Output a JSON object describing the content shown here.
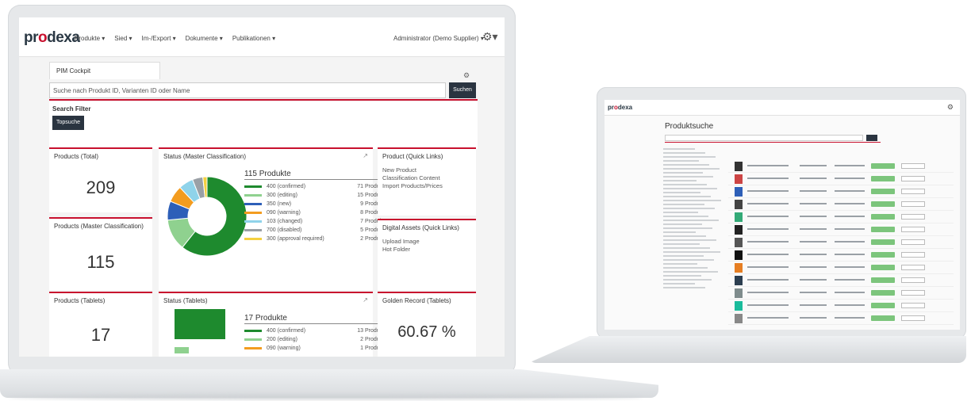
{
  "nav": {
    "logo_pre": "pr",
    "logo_accent": "o",
    "logo_post": "dexa",
    "menu": [
      "Produkte ▾",
      "Sied ▾",
      "Im-/Export ▾",
      "Dokumente ▾",
      "Publikationen ▾"
    ],
    "user": "Administrator (Demo Supplier) ▾"
  },
  "tab": {
    "label": "PIM Cockpit"
  },
  "search": {
    "placeholder": "Suche nach Produkt ID, Varianten ID oder Name",
    "button": "Suchen"
  },
  "filter": {
    "title": "Search Filter",
    "button": "Topsuche"
  },
  "cards": {
    "products_total": {
      "title": "Products (Total)",
      "value": "209"
    },
    "products_master": {
      "title": "Products (Master Classification)",
      "value": "115"
    },
    "products_tablets": {
      "title": "Products (Tablets)",
      "value": "17"
    },
    "status_master": {
      "title": "Status (Master Classification)",
      "heading": "115 Produkte",
      "legend": [
        {
          "label": "400 (confirmed)",
          "count": "71 Produkte",
          "color": "#1e8a2e"
        },
        {
          "label": "300 (editing)",
          "count": "15 Produkte",
          "color": "#8fd18f"
        },
        {
          "label": "350 (new)",
          "count": "9 Produkte",
          "color": "#2d5fb8"
        },
        {
          "label": "090 (warning)",
          "count": "8 Produkte",
          "color": "#f39c1f"
        },
        {
          "label": "103 (changed)",
          "count": "7 Produkte",
          "color": "#8fd3ea"
        },
        {
          "label": "700 (disabled)",
          "count": "5 Produkte",
          "color": "#9aa0a6"
        },
        {
          "label": "300 (approval required)",
          "count": "2 Produkte",
          "color": "#f4d03f"
        }
      ]
    },
    "status_tablets": {
      "title": "Status (Tablets)",
      "heading": "17 Produkte",
      "legend": [
        {
          "label": "400 (confirmed)",
          "count": "13 Produkte",
          "color": "#1e8a2e"
        },
        {
          "label": "200 (editing)",
          "count": "2 Produkte",
          "color": "#8fd18f"
        },
        {
          "label": "090 (warning)",
          "count": "1 Produkte",
          "color": "#f39c1f"
        }
      ]
    },
    "quick_links": {
      "title": "Product (Quick Links)",
      "links": [
        "New Product",
        "Classification Content",
        "Import Products/Prices"
      ]
    },
    "digital_assets": {
      "title": "Digital Assets (Quick Links)",
      "links": [
        "Upload Image",
        "Hot Folder"
      ]
    },
    "golden_record": {
      "title": "Golden Record (Tablets)",
      "value": "60.67 %"
    }
  },
  "small_screen": {
    "title": "Produktsuche",
    "logo_pre": "pr",
    "logo_accent": "o",
    "logo_post": "dexa"
  }
}
